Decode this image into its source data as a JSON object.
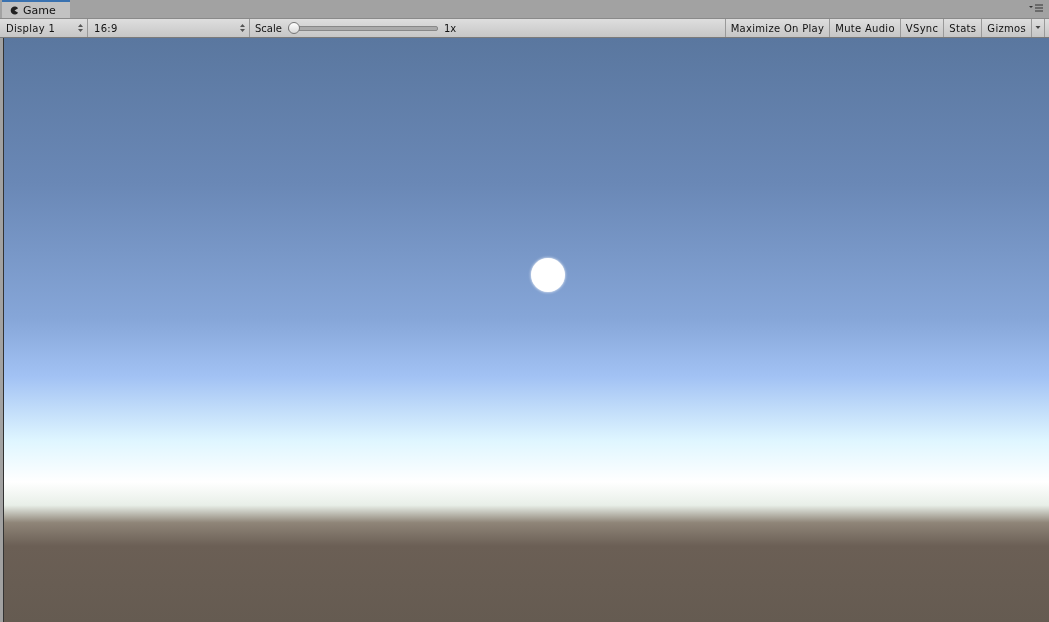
{
  "tab": {
    "label": "Game",
    "selected": true
  },
  "toolbar": {
    "display": "Display 1",
    "aspect": "16:9",
    "scale": {
      "label": "Scale",
      "level": 0,
      "reading": "1x"
    },
    "toggles": [
      {
        "label": "Maximize On Play",
        "on": false
      },
      {
        "label": "Mute Audio",
        "on": false
      },
      {
        "label": "VSync",
        "on": false
      },
      {
        "label": "Stats",
        "on": false
      },
      {
        "label": "Gizmos",
        "on": false
      }
    ]
  }
}
